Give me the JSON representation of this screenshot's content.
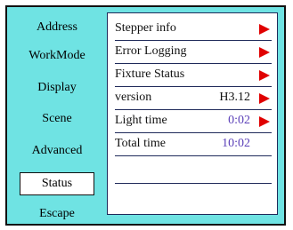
{
  "menu": {
    "items": [
      {
        "label": "Address"
      },
      {
        "label": "WorkMode"
      },
      {
        "label": "Display"
      },
      {
        "label": "Scene"
      },
      {
        "label": "Advanced"
      },
      {
        "label": "Status",
        "selected": true
      },
      {
        "label": "Escape"
      }
    ]
  },
  "panel": {
    "rows": [
      {
        "label": "Stepper info",
        "value": "",
        "arrow": true
      },
      {
        "label": "Error Logging",
        "value": "",
        "arrow": true
      },
      {
        "label": "Fixture Status",
        "value": "",
        "arrow": true
      },
      {
        "label": "version",
        "value": "H3.12",
        "arrow": true
      },
      {
        "label": "Light time",
        "value": "0:02",
        "arrow": true,
        "value_color": "purple"
      },
      {
        "label": "Total time",
        "value": "10:02",
        "arrow": false,
        "value_color": "purple"
      }
    ]
  },
  "colors": {
    "background": "#6fe3e3",
    "panel": "#ffffff",
    "arrow": "#e00000",
    "value_purple": "#5a3fb8"
  },
  "icons": {
    "row_arrow": "red-right-triangle-icon"
  }
}
